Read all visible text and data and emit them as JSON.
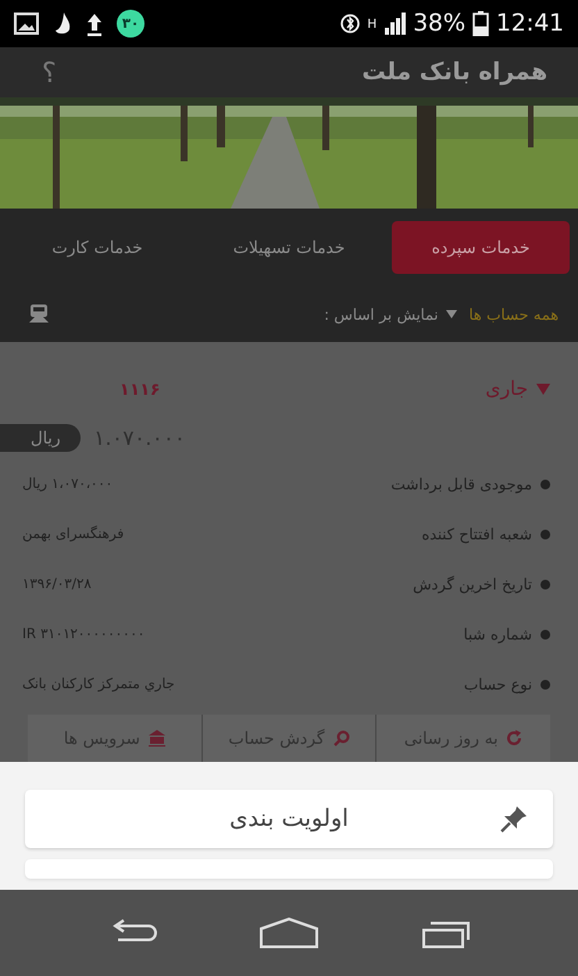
{
  "status_bar": {
    "notification_count": "۳۰",
    "network": "H",
    "battery": "38%",
    "time": "12:41"
  },
  "app_bar": {
    "title": "همراه بانک ملت",
    "help": "؟"
  },
  "tabs": [
    {
      "label": "خدمات سپرده",
      "selected": true
    },
    {
      "label": "خدمات تسهیلات",
      "selected": false
    },
    {
      "label": "خدمات کارت",
      "selected": false
    }
  ],
  "filter": {
    "label": "نمایش بر اساس :",
    "value": "همه حساب ها"
  },
  "account": {
    "type": "جاری",
    "expanded": true,
    "number": "۱۱۱۶",
    "balance": "۱.۰۷۰.۰۰۰",
    "currency": "ریال",
    "details": [
      {
        "label": "موجودی قابل برداشت",
        "value": "۱،۰۷۰،۰۰۰ ریال"
      },
      {
        "label": "شعبه افتتاح کننده",
        "value": "فرهنگسرای بهمن"
      },
      {
        "label": "تاریخ اخرین گردش",
        "value": "۱۳۹۶/۰۳/۲۸"
      },
      {
        "label": "شماره شبا",
        "value": "IR ۳۱۰۱۲۰۰۰۰۰۰۰۰۰"
      },
      {
        "label": "نوع حساب",
        "value": "جاري متمركز كاركنان بانک"
      }
    ],
    "actions": [
      {
        "label": "به روز رسانی",
        "kind": "refresh"
      },
      {
        "label": "گردش حساب",
        "kind": "search"
      },
      {
        "label": "سرویس ها",
        "kind": "services"
      }
    ]
  },
  "sheet": {
    "items": [
      {
        "label": "اولویت بندی",
        "kind": "pin"
      },
      {
        "kind": "empty"
      }
    ]
  }
}
